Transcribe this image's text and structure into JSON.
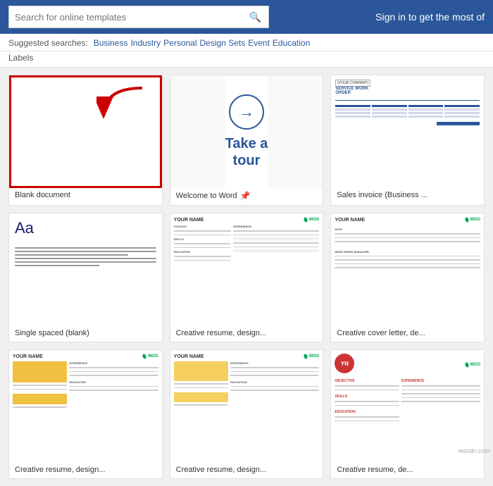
{
  "header": {
    "search_placeholder": "Search for online templates",
    "search_icon": "🔍",
    "sign_in_text": "Sign in to get the most of"
  },
  "suggestions": {
    "label": "Suggested searches:",
    "items": [
      "Business",
      "Industry",
      "Personal",
      "Design Sets",
      "Event",
      "Education"
    ]
  },
  "section_label": "Labels",
  "templates": [
    {
      "id": "blank",
      "label": "Blank document",
      "type": "blank",
      "pinnable": false
    },
    {
      "id": "tour",
      "label": "Welcome to Word",
      "type": "tour",
      "pinnable": true
    },
    {
      "id": "invoice",
      "label": "Sales invoice (Business ...",
      "type": "invoice",
      "pinnable": false
    },
    {
      "id": "single",
      "label": "Single spaced (blank)",
      "type": "single",
      "pinnable": false
    },
    {
      "id": "resume1",
      "label": "Creative resume, design...",
      "type": "resume",
      "pinnable": false
    },
    {
      "id": "cover1",
      "label": "Creative cover letter, de...",
      "type": "cover",
      "pinnable": false
    },
    {
      "id": "resume2",
      "label": "Creative resume, design...",
      "type": "resume2",
      "pinnable": false
    },
    {
      "id": "resume3",
      "label": "Creative resume, design...",
      "type": "resume3",
      "pinnable": false
    },
    {
      "id": "yn-resume",
      "label": "Creative resume, de...",
      "type": "yn",
      "pinnable": false
    }
  ],
  "pin_symbol": "📌"
}
